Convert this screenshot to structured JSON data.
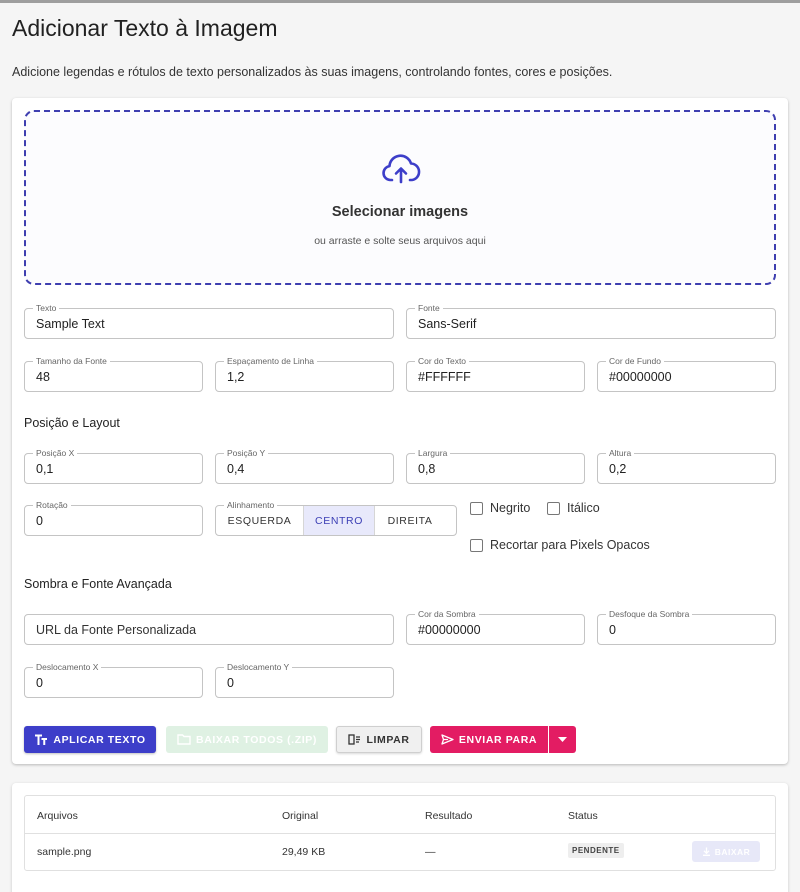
{
  "header": {
    "title": "Adicionar Texto à Imagem",
    "description": "Adicione legendas e rótulos de texto personalizados às suas imagens, controlando fontes, cores e posições."
  },
  "dropzone": {
    "icon": "cloud-upload-icon",
    "title": "Selecionar imagens",
    "subtitle": "ou arraste e solte seus arquivos aqui"
  },
  "fields": {
    "text": {
      "label": "Texto",
      "value": "Sample Text"
    },
    "font": {
      "label": "Fonte",
      "value": "Sans-Serif"
    },
    "font_size": {
      "label": "Tamanho da Fonte",
      "value": "48"
    },
    "line_spacing": {
      "label": "Espaçamento de Linha",
      "value": "1,2"
    },
    "text_color": {
      "label": "Cor do Texto",
      "value": "#FFFFFF"
    },
    "bg_color": {
      "label": "Cor de Fundo",
      "value": "#00000000"
    }
  },
  "layout": {
    "section_title": "Posição e Layout",
    "pos_x": {
      "label": "Posição X",
      "value": "0,1"
    },
    "pos_y": {
      "label": "Posição Y",
      "value": "0,4"
    },
    "width": {
      "label": "Largura",
      "value": "0,8"
    },
    "height": {
      "label": "Altura",
      "value": "0,2"
    },
    "rotation": {
      "label": "Rotação",
      "value": "0"
    },
    "alignment": {
      "label": "Alinhamento",
      "options": [
        "ESQUERDA",
        "CENTRO",
        "DIREITA"
      ],
      "selected": "CENTRO"
    },
    "bold_label": "Negrito",
    "italic_label": "Itálico",
    "crop_label": "Recortar para Pixels Opacos"
  },
  "advanced": {
    "section_title": "Sombra e Fonte Avançada",
    "custom_font_url": {
      "placeholder": "URL da Fonte Personalizada"
    },
    "shadow_color": {
      "label": "Cor da Sombra",
      "value": "#00000000"
    },
    "shadow_blur": {
      "label": "Desfoque da Sombra",
      "value": "0"
    },
    "offset_x": {
      "label": "Deslocamento X",
      "value": "0"
    },
    "offset_y": {
      "label": "Deslocamento Y",
      "value": "0"
    }
  },
  "actions": {
    "apply": "APLICAR TEXTO",
    "download_all": "BAIXAR TODOS (.ZIP)",
    "clear": "LIMPAR",
    "send_to": "ENVIAR PARA"
  },
  "files": {
    "columns": [
      "Arquivos",
      "Original",
      "Resultado",
      "Status"
    ],
    "rows": [
      {
        "name": "sample.png",
        "original": "29,49 KB",
        "result": "—",
        "status": "PENDENTE",
        "action": "BAIXAR"
      }
    ]
  },
  "colors": {
    "primary": "#3d3ec9",
    "accent": "#e31c63",
    "dropzone_border": "#3f3fb0"
  }
}
